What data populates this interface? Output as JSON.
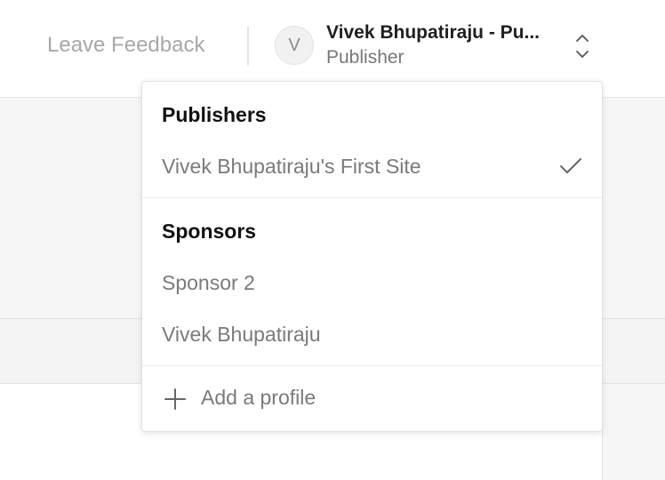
{
  "header": {
    "feedback_label": "Leave Feedback",
    "avatar_letter": "V",
    "profile_name": "Vivek Bhupatiraju - Pu...",
    "profile_role": "Publisher"
  },
  "dropdown": {
    "publishers_title": "Publishers",
    "publishers": [
      {
        "label": "Vivek Bhupatiraju's First Site",
        "selected": true
      }
    ],
    "sponsors_title": "Sponsors",
    "sponsors": [
      {
        "label": "Sponsor 2"
      },
      {
        "label": "Vivek Bhupatiraju"
      }
    ],
    "add_profile_label": "Add a profile"
  },
  "icons": {
    "chevrons": "chevron-up-down-icon",
    "check": "checkmark-icon",
    "plus": "plus-icon"
  },
  "colors": {
    "text_dark": "#111111",
    "text_muted": "#7a7a7a",
    "feedback_text": "#a8a8a8"
  }
}
